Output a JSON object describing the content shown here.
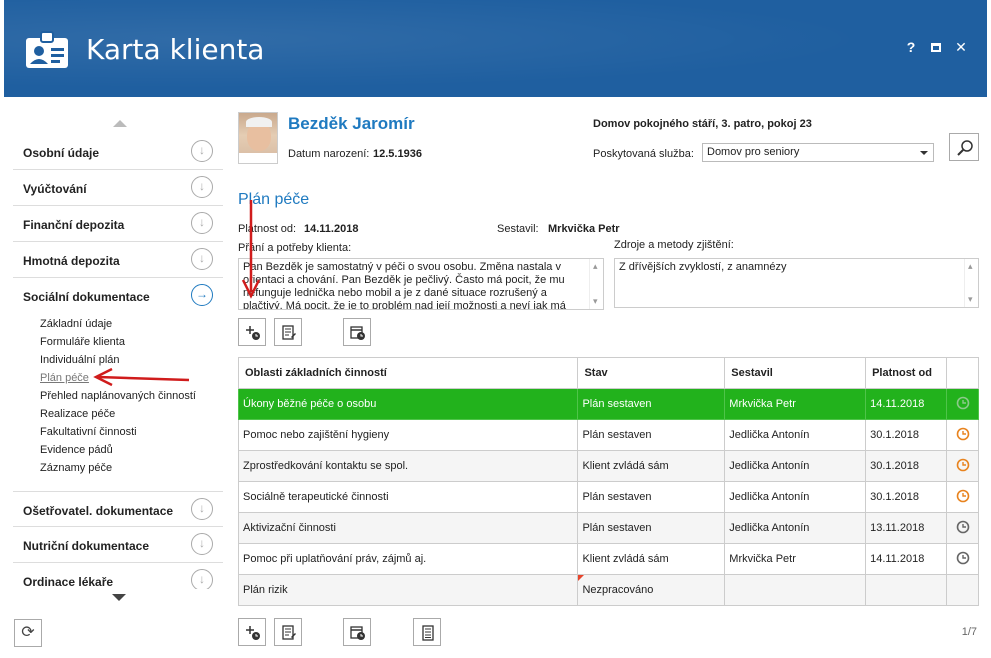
{
  "app": {
    "title": "Karta klienta",
    "help": "?",
    "maximize": "",
    "close": "✕"
  },
  "sidebar": {
    "sections": [
      {
        "label": "Osobní údaje"
      },
      {
        "label": "Vyúčtování"
      },
      {
        "label": "Finanční depozita"
      },
      {
        "label": "Hmotná depozita"
      },
      {
        "label": "Sociální dokumentace"
      },
      {
        "label": "Ošetřovatel. dokumentace"
      },
      {
        "label": "Nutriční dokumentace"
      },
      {
        "label": "Ordinace lékaře"
      }
    ],
    "subitems": [
      "Základní údaje",
      "Formuláře klienta",
      "Individuální plán",
      "Plán péče",
      "Přehled naplánovaných činností",
      "Realizace péče",
      "Fakultativní činnosti",
      "Evidence pádů",
      "Záznamy péče"
    ]
  },
  "client": {
    "name": "Bezděk Jaromír",
    "dob_label": "Datum narození:",
    "dob": "12.5.1936",
    "facility": "Domov pokojného stáří, 3. patro, pokoj 23",
    "service_label": "Poskytovaná služba:",
    "service_value": "Domov pro seniory"
  },
  "plan": {
    "title": "Plán péče",
    "valid_from_label": "Platnost od:",
    "valid_from": "14.11.2018",
    "author_label": "Sestavil:",
    "author": "Mrkvička Petr",
    "wishes_label": "Přání a potřeby klienta:",
    "wishes_text": "Pan Bezděk je samostatný v péči o svou osobu. Změna nastala v orientaci a chování. Pan Bezděk je pečlivý. Často má pocit, že mu nefunguje lednička nebo mobil a je z dané situace rozrušený a plačtivý. Má pocit, že je to problém nad její možnosti a neví jak má situaci řešit.",
    "sources_label": "Zdroje a metody zjištění:",
    "sources_text": "Z dřívějších zvyklostí, z anamnézy"
  },
  "table": {
    "headers": [
      "Oblasti základních činností",
      "Stav",
      "Sestavil",
      "Platnost od"
    ],
    "rows": [
      {
        "area": "Úkony běžné péče o osobu",
        "status": "Plán sestaven",
        "author": "Mrkvička Petr",
        "valid": "14.11.2018",
        "icon": "clock-grey"
      },
      {
        "area": "Pomoc nebo zajištění hygieny",
        "status": "Plán sestaven",
        "author": "Jedlička Antonín",
        "valid": "30.1.2018",
        "icon": "clock-orange"
      },
      {
        "area": "Zprostředkování kontaktu se spol.",
        "status": "Klient zvládá sám",
        "author": "Jedlička Antonín",
        "valid": "30.1.2018",
        "icon": "clock-orange"
      },
      {
        "area": "Sociálně terapeutické činnosti",
        "status": "Plán sestaven",
        "author": "Jedlička Antonín",
        "valid": "30.1.2018",
        "icon": "clock-orange"
      },
      {
        "area": "Aktivizační činnosti",
        "status": "Plán sestaven",
        "author": "Jedlička Antonín",
        "valid": "13.11.2018",
        "icon": "clock-grey"
      },
      {
        "area": "Pomoc při uplatňování práv, zájmů aj.",
        "status": "Klient zvládá sám",
        "author": "Mrkvička Petr",
        "valid": "14.11.2018",
        "icon": "clock-grey"
      },
      {
        "area": "Plán rizik",
        "status": "Nezpracováno",
        "author": "",
        "valid": "",
        "icon": ""
      }
    ]
  },
  "pager": {
    "text": "1/7"
  },
  "colors": {
    "header": "#1f5fa0",
    "accent": "#1f7ac0",
    "selected_row": "#22b21c",
    "orange": "#e8831e",
    "arrow": "#d01c1c"
  }
}
